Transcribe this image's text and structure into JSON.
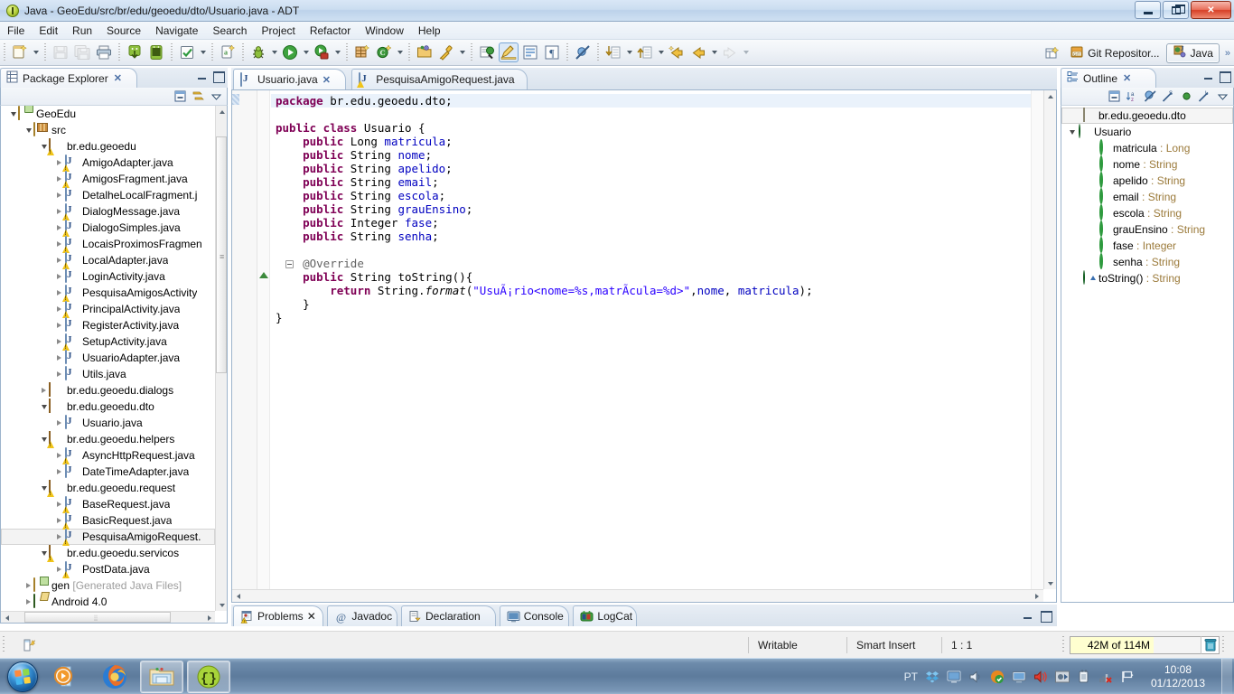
{
  "window": {
    "title": "Java - GeoEdu/src/br/edu/geoedu/dto/Usuario.java - ADT",
    "app_icon": "eclipse-icon",
    "minimize_label": "Minimize",
    "maximize_label": "Maximize",
    "close_label": "Close"
  },
  "menubar": {
    "items": [
      {
        "label": "File"
      },
      {
        "label": "Edit"
      },
      {
        "label": "Run"
      },
      {
        "label": "Source"
      },
      {
        "label": "Navigate"
      },
      {
        "label": "Search"
      },
      {
        "label": "Project"
      },
      {
        "label": "Refactor"
      },
      {
        "label": "Window"
      },
      {
        "label": "Help"
      }
    ]
  },
  "toolbar": {
    "groups": [
      {
        "items": [
          {
            "icon": "new-wizard-icon",
            "name": "new-button",
            "dropdown": true
          }
        ]
      },
      {
        "items": [
          {
            "icon": "save-icon",
            "name": "save-button",
            "disabled": true
          },
          {
            "icon": "save-all-icon",
            "name": "save-all-button",
            "disabled": true
          },
          {
            "icon": "print-icon",
            "name": "print-button"
          }
        ]
      },
      {
        "items": [
          {
            "icon": "android-sdk-manager-icon",
            "name": "android-sdk-manager-button"
          },
          {
            "icon": "android-avd-manager-icon",
            "name": "android-avd-manager-button"
          }
        ]
      },
      {
        "items": [
          {
            "icon": "lint-check-icon",
            "name": "lint-warnings-button",
            "dropdown": true
          }
        ]
      },
      {
        "items": [
          {
            "icon": "new-android-xml-icon",
            "name": "new-xml-file-button"
          }
        ]
      },
      {
        "items": [
          {
            "icon": "debug-icon",
            "name": "debug-button",
            "dropdown": true
          },
          {
            "icon": "run-icon",
            "name": "run-button",
            "dropdown": true
          },
          {
            "icon": "external-tools-icon",
            "name": "external-tools-button",
            "dropdown": true
          }
        ]
      },
      {
        "items": [
          {
            "icon": "new-java-package-icon",
            "name": "new-package-button"
          },
          {
            "icon": "new-java-class-icon",
            "name": "new-class-button",
            "dropdown": true
          }
        ]
      },
      {
        "items": [
          {
            "icon": "open-type-icon",
            "name": "open-type-button"
          },
          {
            "icon": "search-icon",
            "name": "search-button",
            "dropdown": true
          }
        ]
      },
      {
        "items": [
          {
            "icon": "last-edit-location-icon",
            "name": "last-edit-location-button"
          },
          {
            "icon": "toggle-mark-occurrences-icon",
            "name": "toggle-mark-occurrences-button",
            "pressed": true
          },
          {
            "icon": "toggle-block-selection-icon",
            "name": "toggle-block-selection-button"
          },
          {
            "icon": "show-whitespace-icon",
            "name": "show-whitespace-button"
          }
        ]
      },
      {
        "items": [
          {
            "icon": "skip-all-breakpoints-icon",
            "name": "skip-all-breakpoints-button"
          }
        ]
      },
      {
        "items": [
          {
            "icon": "next-annotation-icon",
            "name": "next-annotation-button",
            "dropdown": true
          },
          {
            "icon": "previous-annotation-icon",
            "name": "previous-annotation-button",
            "dropdown": true
          },
          {
            "icon": "last-edit-back-icon",
            "name": "last-edit-position-button"
          },
          {
            "icon": "back-arrow-icon",
            "name": "back-button",
            "dropdown": true
          },
          {
            "icon": "forward-arrow-icon",
            "name": "forward-button",
            "dropdown": true,
            "disabled": true
          }
        ]
      }
    ],
    "perspectives": {
      "open_perspective_icon": "open-perspective-icon",
      "items": [
        {
          "label": "Git Repositor...",
          "icon": "git-repository-icon",
          "active": false
        },
        {
          "label": "Java",
          "icon": "java-perspective-icon",
          "active": true
        }
      ],
      "overflow": "»"
    }
  },
  "package_explorer": {
    "tab_label": "Package Explorer",
    "close_glyph": "✕",
    "toolbar_icons": [
      "collapse-all-icon",
      "link-with-editor-icon",
      "view-menu-icon"
    ],
    "tree": [
      {
        "indent": 0,
        "twist": "open",
        "icon": "java-project-icon",
        "label": "GeoEdu"
      },
      {
        "indent": 1,
        "twist": "open",
        "icon": "source-folder-icon",
        "label": "src"
      },
      {
        "indent": 2,
        "twist": "open",
        "icon": "package-warn-icon",
        "label": "br.edu.geoedu"
      },
      {
        "indent": 3,
        "twist": "closed",
        "icon": "java-warn-icon",
        "label": "AmigoAdapter.java"
      },
      {
        "indent": 3,
        "twist": "closed",
        "icon": "java-warn-icon",
        "label": "AmigosFragment.java"
      },
      {
        "indent": 3,
        "twist": "closed",
        "icon": "java-icon",
        "label": "DetalheLocalFragment.j"
      },
      {
        "indent": 3,
        "twist": "closed",
        "icon": "java-warn-icon",
        "label": "DialogMessage.java"
      },
      {
        "indent": 3,
        "twist": "closed",
        "icon": "java-warn-icon",
        "label": "DialogoSimples.java"
      },
      {
        "indent": 3,
        "twist": "closed",
        "icon": "java-warn-icon",
        "label": "LocaisProximosFragmen"
      },
      {
        "indent": 3,
        "twist": "closed",
        "icon": "java-warn-icon",
        "label": "LocalAdapter.java"
      },
      {
        "indent": 3,
        "twist": "closed",
        "icon": "java-icon",
        "label": "LoginActivity.java"
      },
      {
        "indent": 3,
        "twist": "closed",
        "icon": "java-warn-icon",
        "label": "PesquisaAmigosActivity"
      },
      {
        "indent": 3,
        "twist": "closed",
        "icon": "java-warn-icon",
        "label": "PrincipalActivity.java"
      },
      {
        "indent": 3,
        "twist": "closed",
        "icon": "java-icon",
        "label": "RegisterActivity.java"
      },
      {
        "indent": 3,
        "twist": "closed",
        "icon": "java-warn-icon",
        "label": "SetupActivity.java"
      },
      {
        "indent": 3,
        "twist": "closed",
        "icon": "java-icon",
        "label": "UsuarioAdapter.java"
      },
      {
        "indent": 3,
        "twist": "closed",
        "icon": "java-icon",
        "label": "Utils.java"
      },
      {
        "indent": 2,
        "twist": "closed",
        "icon": "package-icon",
        "label": "br.edu.geoedu.dialogs"
      },
      {
        "indent": 2,
        "twist": "open",
        "icon": "package-icon",
        "label": "br.edu.geoedu.dto"
      },
      {
        "indent": 3,
        "twist": "closed",
        "icon": "java-icon",
        "label": "Usuario.java"
      },
      {
        "indent": 2,
        "twist": "open",
        "icon": "package-warn-icon",
        "label": "br.edu.geoedu.helpers"
      },
      {
        "indent": 3,
        "twist": "closed",
        "icon": "java-warn-icon",
        "label": "AsyncHttpRequest.java"
      },
      {
        "indent": 3,
        "twist": "closed",
        "icon": "java-icon",
        "label": "DateTimeAdapter.java"
      },
      {
        "indent": 2,
        "twist": "open",
        "icon": "package-warn-icon",
        "label": "br.edu.geoedu.request"
      },
      {
        "indent": 3,
        "twist": "closed",
        "icon": "java-warn-icon",
        "label": "BaseRequest.java"
      },
      {
        "indent": 3,
        "twist": "closed",
        "icon": "java-warn-icon",
        "label": "BasicRequest.java"
      },
      {
        "indent": 3,
        "twist": "closed",
        "icon": "java-warn-icon",
        "label": "PesquisaAmigoRequest.",
        "selected": true
      },
      {
        "indent": 2,
        "twist": "open",
        "icon": "package-warn-icon",
        "label": "br.edu.geoedu.servicos"
      },
      {
        "indent": 3,
        "twist": "closed",
        "icon": "java-warn-icon",
        "label": "PostData.java"
      },
      {
        "indent": 1,
        "twist": "closed",
        "icon": "gen-folder-icon",
        "label": "gen ",
        "suffix": "[Generated Java Files]"
      },
      {
        "indent": 1,
        "twist": "closed",
        "icon": "library-icon",
        "label": "Android 4.0"
      }
    ]
  },
  "editor": {
    "tabs": [
      {
        "label": "Usuario.java",
        "icon": "java-icon",
        "active": true,
        "closable": true
      },
      {
        "label": "PesquisaAmigoRequest.java",
        "icon": "java-warn-icon",
        "active": false,
        "closable": false
      }
    ],
    "code_lines": [
      {
        "current": true,
        "tokens": [
          {
            "t": "kw",
            "s": "package"
          },
          {
            "t": "",
            "s": " br.edu.geoedu.dto;"
          }
        ]
      },
      {
        "tokens": []
      },
      {
        "tokens": [
          {
            "t": "kw",
            "s": "public class"
          },
          {
            "t": "",
            "s": " Usuario {"
          }
        ]
      },
      {
        "tokens": [
          {
            "t": "",
            "s": "    "
          },
          {
            "t": "kw",
            "s": "public"
          },
          {
            "t": "",
            "s": " Long "
          },
          {
            "t": "fld",
            "s": "matricula"
          },
          {
            "t": "",
            "s": ";"
          }
        ]
      },
      {
        "tokens": [
          {
            "t": "",
            "s": "    "
          },
          {
            "t": "kw",
            "s": "public"
          },
          {
            "t": "",
            "s": " String "
          },
          {
            "t": "fld",
            "s": "nome"
          },
          {
            "t": "",
            "s": ";"
          }
        ]
      },
      {
        "tokens": [
          {
            "t": "",
            "s": "    "
          },
          {
            "t": "kw",
            "s": "public"
          },
          {
            "t": "",
            "s": " String "
          },
          {
            "t": "fld",
            "s": "apelido"
          },
          {
            "t": "",
            "s": ";"
          }
        ]
      },
      {
        "tokens": [
          {
            "t": "",
            "s": "    "
          },
          {
            "t": "kw",
            "s": "public"
          },
          {
            "t": "",
            "s": " String "
          },
          {
            "t": "fld",
            "s": "email"
          },
          {
            "t": "",
            "s": ";"
          }
        ]
      },
      {
        "tokens": [
          {
            "t": "",
            "s": "    "
          },
          {
            "t": "kw",
            "s": "public"
          },
          {
            "t": "",
            "s": " String "
          },
          {
            "t": "fld",
            "s": "escola"
          },
          {
            "t": "",
            "s": ";"
          }
        ]
      },
      {
        "tokens": [
          {
            "t": "",
            "s": "    "
          },
          {
            "t": "kw",
            "s": "public"
          },
          {
            "t": "",
            "s": " String "
          },
          {
            "t": "fld",
            "s": "grauEnsino"
          },
          {
            "t": "",
            "s": ";"
          }
        ]
      },
      {
        "tokens": [
          {
            "t": "",
            "s": "    "
          },
          {
            "t": "kw",
            "s": "public"
          },
          {
            "t": "",
            "s": " Integer "
          },
          {
            "t": "fld",
            "s": "fase"
          },
          {
            "t": "",
            "s": ";"
          }
        ]
      },
      {
        "tokens": [
          {
            "t": "",
            "s": "    "
          },
          {
            "t": "kw",
            "s": "public"
          },
          {
            "t": "",
            "s": " String "
          },
          {
            "t": "fld",
            "s": "senha"
          },
          {
            "t": "",
            "s": ";"
          }
        ]
      },
      {
        "tokens": []
      },
      {
        "tokens": [
          {
            "t": "",
            "s": "    "
          },
          {
            "t": "ann",
            "s": "@Override"
          }
        ]
      },
      {
        "tokens": [
          {
            "t": "",
            "s": "    "
          },
          {
            "t": "kw",
            "s": "public"
          },
          {
            "t": "",
            "s": " String toString(){"
          }
        ]
      },
      {
        "tokens": [
          {
            "t": "",
            "s": "        "
          },
          {
            "t": "kw",
            "s": "return"
          },
          {
            "t": "",
            "s": " String."
          },
          {
            "t": "mth",
            "s": "format"
          },
          {
            "t": "",
            "s": "("
          },
          {
            "t": "str",
            "s": "\"UsuÃ¡rio<nome=%s,matrÃ­cula=%d>\""
          },
          {
            "t": "",
            "s": ","
          },
          {
            "t": "fld",
            "s": "nome"
          },
          {
            "t": "",
            "s": ", "
          },
          {
            "t": "fld",
            "s": "matricula"
          },
          {
            "t": "",
            "s": ");"
          }
        ]
      },
      {
        "tokens": [
          {
            "t": "",
            "s": "    }"
          }
        ]
      },
      {
        "tokens": [
          {
            "t": "",
            "s": "}"
          }
        ]
      }
    ]
  },
  "outline": {
    "tab_label": "Outline",
    "close_glyph": "✕",
    "toolbar_icons": [
      "collapse-all-icon",
      "sort-icon",
      "hide-fields-icon",
      "hide-static-icon",
      "hide-non-public-icon",
      "hide-local-types-icon",
      "view-menu-icon"
    ],
    "items": [
      {
        "indent": 1,
        "icon": "package-declaration-icon",
        "name": "br.edu.geoedu.dto",
        "type": "",
        "selected": true
      },
      {
        "indent": 0,
        "twist": "open",
        "icon": "class-icon",
        "name": "Usuario",
        "type": ""
      },
      {
        "indent": 2,
        "icon": "public-field-icon",
        "name": "matricula",
        "type": " : Long"
      },
      {
        "indent": 2,
        "icon": "public-field-icon",
        "name": "nome",
        "type": " : String"
      },
      {
        "indent": 2,
        "icon": "public-field-icon",
        "name": "apelido",
        "type": " : String"
      },
      {
        "indent": 2,
        "icon": "public-field-icon",
        "name": "email",
        "type": " : String"
      },
      {
        "indent": 2,
        "icon": "public-field-icon",
        "name": "escola",
        "type": " : String"
      },
      {
        "indent": 2,
        "icon": "public-field-icon",
        "name": "grauEnsino",
        "type": " : String"
      },
      {
        "indent": 2,
        "icon": "public-field-icon",
        "name": "fase",
        "type": " : Integer"
      },
      {
        "indent": 2,
        "icon": "public-field-icon",
        "name": "senha",
        "type": " : String"
      },
      {
        "indent": 1,
        "icon": "public-method-override-icon",
        "name": "toString()",
        "type": " : String"
      }
    ]
  },
  "bottom_panel": {
    "tabs": [
      {
        "label": "Problems",
        "icon": "problems-icon",
        "active": true,
        "closable": true,
        "close_glyph": "✕"
      },
      {
        "label": "Javadoc",
        "icon": "javadoc-icon",
        "active": false
      },
      {
        "label": "Declaration",
        "icon": "declaration-icon",
        "active": false
      },
      {
        "label": "Console",
        "icon": "console-icon",
        "active": false
      },
      {
        "label": "LogCat",
        "icon": "logcat-icon",
        "active": false
      }
    ],
    "controls": [
      "minimize-icon",
      "maximize-icon"
    ]
  },
  "status_bar": {
    "left_icon": "editor-smart-insert-icon",
    "writable": "Writable",
    "insert_mode": "Smart Insert",
    "position": "1 : 1",
    "heap": {
      "used_label": "42M of 114M",
      "trash_icon": "trash-icon"
    }
  },
  "taskbar": {
    "start": "start-orb",
    "buttons": [
      {
        "icon": "windows-media-player-icon",
        "name": "taskbar-media-player",
        "framed": false
      },
      {
        "icon": "firefox-icon",
        "name": "taskbar-firefox",
        "framed": false
      },
      {
        "icon": "windows-explorer-icon",
        "name": "taskbar-explorer",
        "framed": true
      },
      {
        "icon": "eclipse-adt-icon",
        "name": "taskbar-eclipse",
        "framed": true
      }
    ],
    "tray": {
      "language": "PT",
      "icons": [
        "dropbox-icon",
        "display-icon",
        "volume-low-icon",
        "avg-icon",
        "monitor-icon",
        "volume-icon",
        "settings-icon",
        "power-icon",
        "network-error-icon",
        "action-center-flag-icon"
      ],
      "time": "10:08",
      "date": "01/12/2013"
    }
  },
  "colors": {
    "keyword": "#7f0055",
    "string": "#2a00ff",
    "field": "#0000c0",
    "annotation": "#646464",
    "accent": "#4a6fa5",
    "heap_fill": "#ffffd0"
  }
}
